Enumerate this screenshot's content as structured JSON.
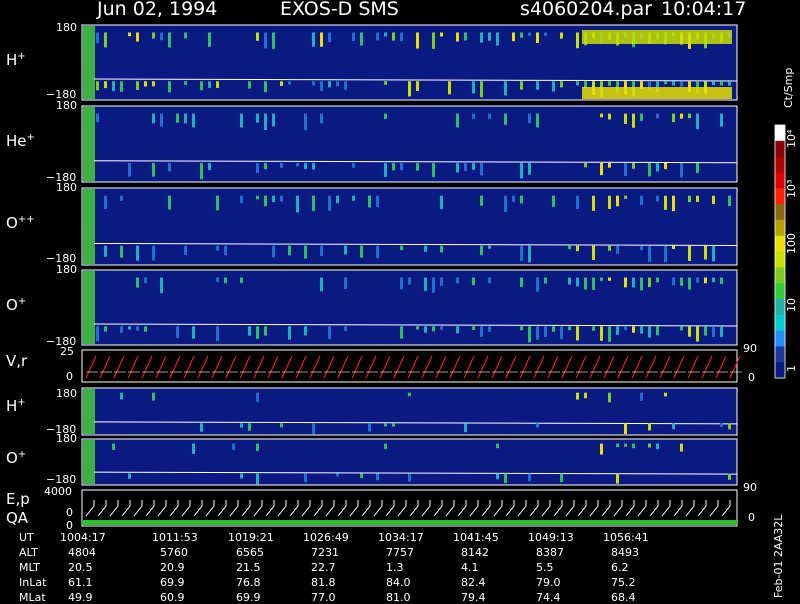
{
  "header": {
    "date": "Jun 02, 1994",
    "instrument": "EXOS-D SMS",
    "file": "s4060204.par",
    "time": "10:04:17"
  },
  "panels": {
    "p1": {
      "label": "H",
      "sup": "+",
      "top": "180",
      "bottom": "−180"
    },
    "p2": {
      "label": "He",
      "sup": "+",
      "top": "180",
      "bottom": "−180"
    },
    "p3": {
      "label": "O",
      "sup": "++",
      "top": "180",
      "bottom": "−180"
    },
    "p4": {
      "label": "O",
      "sup": "+",
      "top": "180",
      "bottom": "−180"
    },
    "p5": {
      "label": "V,r",
      "top": "25",
      "mid": "0",
      "right_top": "90",
      "right_bottom": "0"
    },
    "p6": {
      "label": "H",
      "sup": "+",
      "top": "180",
      "bottom": "−180"
    },
    "p7": {
      "label": "O",
      "sup": "+",
      "top": "180",
      "bottom": "−180"
    },
    "p8": {
      "label1": "E,p",
      "label2": "QA",
      "top": "4000",
      "mid": "0",
      "mid2": "0",
      "right_top": "90",
      "right_bottom": "0"
    }
  },
  "colorbar": {
    "unit": "Ct/Smp",
    "ticks": [
      "10⁴",
      "10³",
      "100",
      "10",
      "1"
    ],
    "colors": [
      "#ffffff",
      "#8b0000",
      "#b00000",
      "#e00000",
      "#ff2000",
      "#8b6914",
      "#b8a000",
      "#e8e000",
      "#c8e000",
      "#7ccd20",
      "#32cd32",
      "#20b2aa",
      "#00ced1",
      "#1e90ff",
      "#1a3aa0",
      "#0a1a80"
    ]
  },
  "footer": {
    "row_labels": [
      "UT",
      "ALT",
      "MLT",
      "InLat",
      "MLat"
    ],
    "ut": [
      "1004:17",
      "1011:53",
      "1019:21",
      "1026:49",
      "1034:17",
      "1041:45",
      "1049:13",
      "1056:41"
    ],
    "alt": [
      "4804",
      "5760",
      "6565",
      "7231",
      "7757",
      "8142",
      "8387",
      "8493"
    ],
    "mlt": [
      "20.5",
      "20.9",
      "21.5",
      "22.7",
      "1.3",
      "4.1",
      "5.5",
      "6.2"
    ],
    "inlat": [
      "61.1",
      "69.9",
      "76.8",
      "81.8",
      "84.0",
      "82.4",
      "79.0",
      "75.2"
    ],
    "mlat": [
      "49.9",
      "60.9",
      "69.9",
      "77.0",
      "81.0",
      "79.4",
      "74.4",
      "68.4"
    ],
    "side_label": "Feb-01 2AA32L"
  },
  "chart_data": {
    "type": "heatmap",
    "title": "Jun 02, 1994   EXOS-D SMS",
    "panels": [
      "H+",
      "He+",
      "O++",
      "O+",
      "V,r",
      "H+",
      "O+",
      "E,p / QA"
    ],
    "x_ticks_ut": [
      "1004:17",
      "1011:53",
      "1019:21",
      "1026:49",
      "1034:17",
      "1041:45",
      "1049:13",
      "1056:41"
    ],
    "y_range_pitch": [
      -180,
      180
    ],
    "colorbar_label": "Ct/Smp",
    "colorbar_scale": "log",
    "colorbar_ticks": [
      "1",
      "10",
      "100",
      "10³",
      "10⁴"
    ]
  }
}
